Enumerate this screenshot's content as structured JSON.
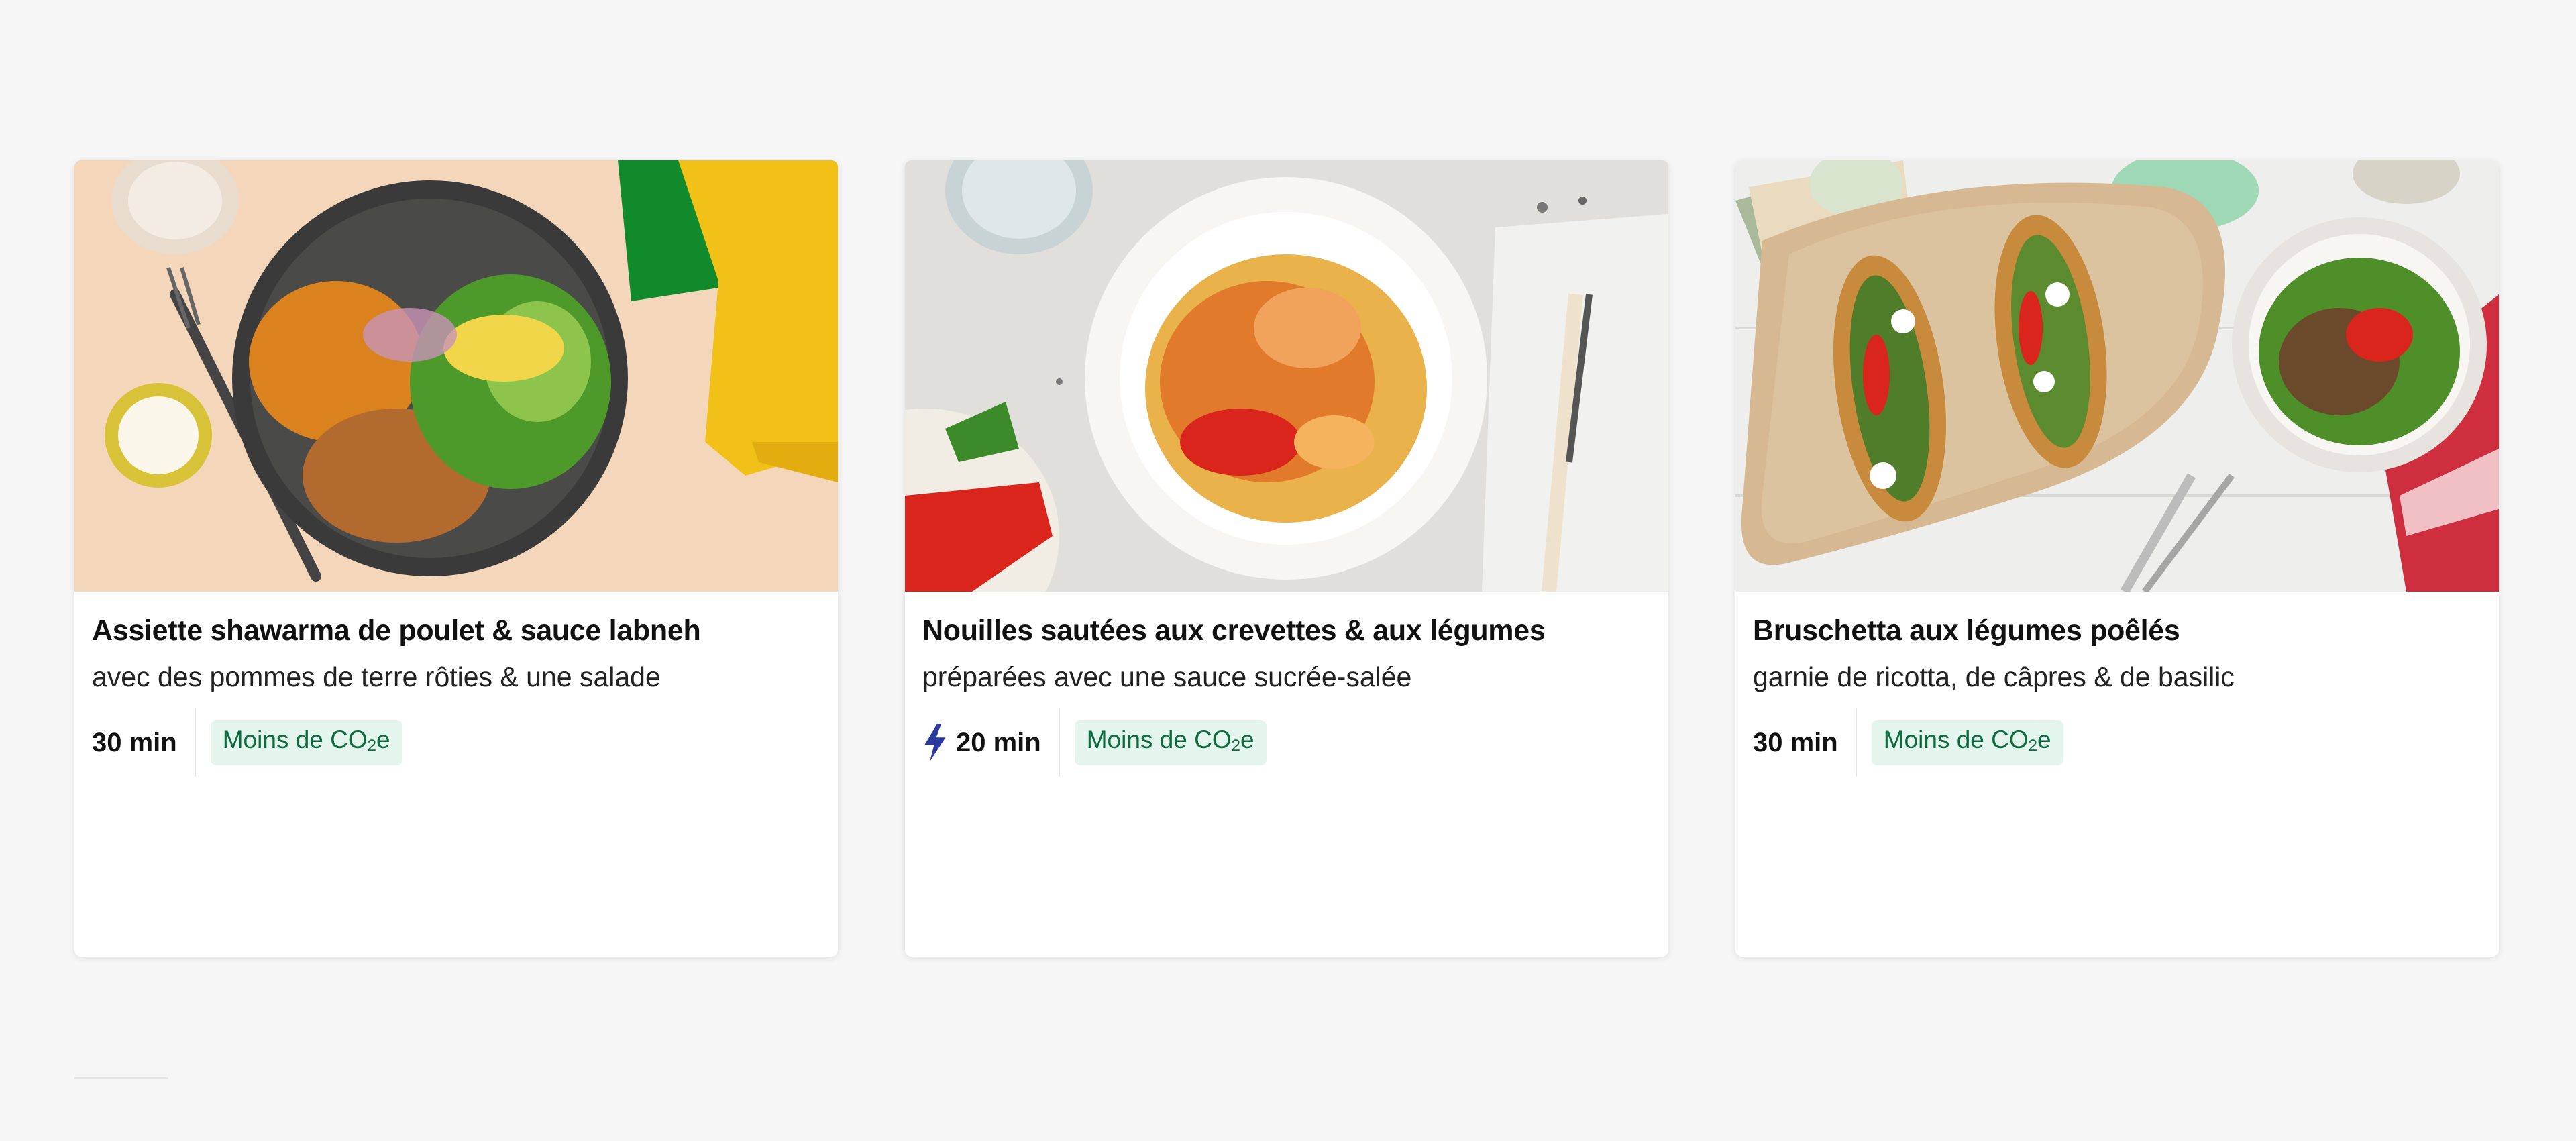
{
  "recipes": [
    {
      "title": "Assiette shawarma de poulet & sauce labneh",
      "subtitle": "avec des pommes de terre rôties & une salade",
      "time": "30 min",
      "quick": false,
      "badge": "Moins de CO",
      "badge_sub": "2",
      "badge_suffix": "e",
      "image_icon": "chicken-shawarma-plate-photo"
    },
    {
      "title": "Nouilles sautées aux crevettes & aux légumes",
      "subtitle": "préparées avec une sauce sucrée-salée",
      "time": "20 min",
      "quick": true,
      "badge": "Moins de CO",
      "badge_sub": "2",
      "badge_suffix": "e",
      "image_icon": "shrimp-noodles-bowl-photo"
    },
    {
      "title": "Bruschetta aux légumes poêlés",
      "subtitle": "garnie de ricotta, de câpres & de basilic",
      "time": "30 min",
      "quick": false,
      "badge": "Moins de CO",
      "badge_sub": "2",
      "badge_suffix": "e",
      "image_icon": "vegetable-bruschetta-photo"
    }
  ],
  "colors": {
    "badge_bg": "#e4f5ee",
    "badge_text": "#0b6b3e",
    "bolt": "#2b3a9e",
    "page_bg": "#f6f6f6"
  }
}
